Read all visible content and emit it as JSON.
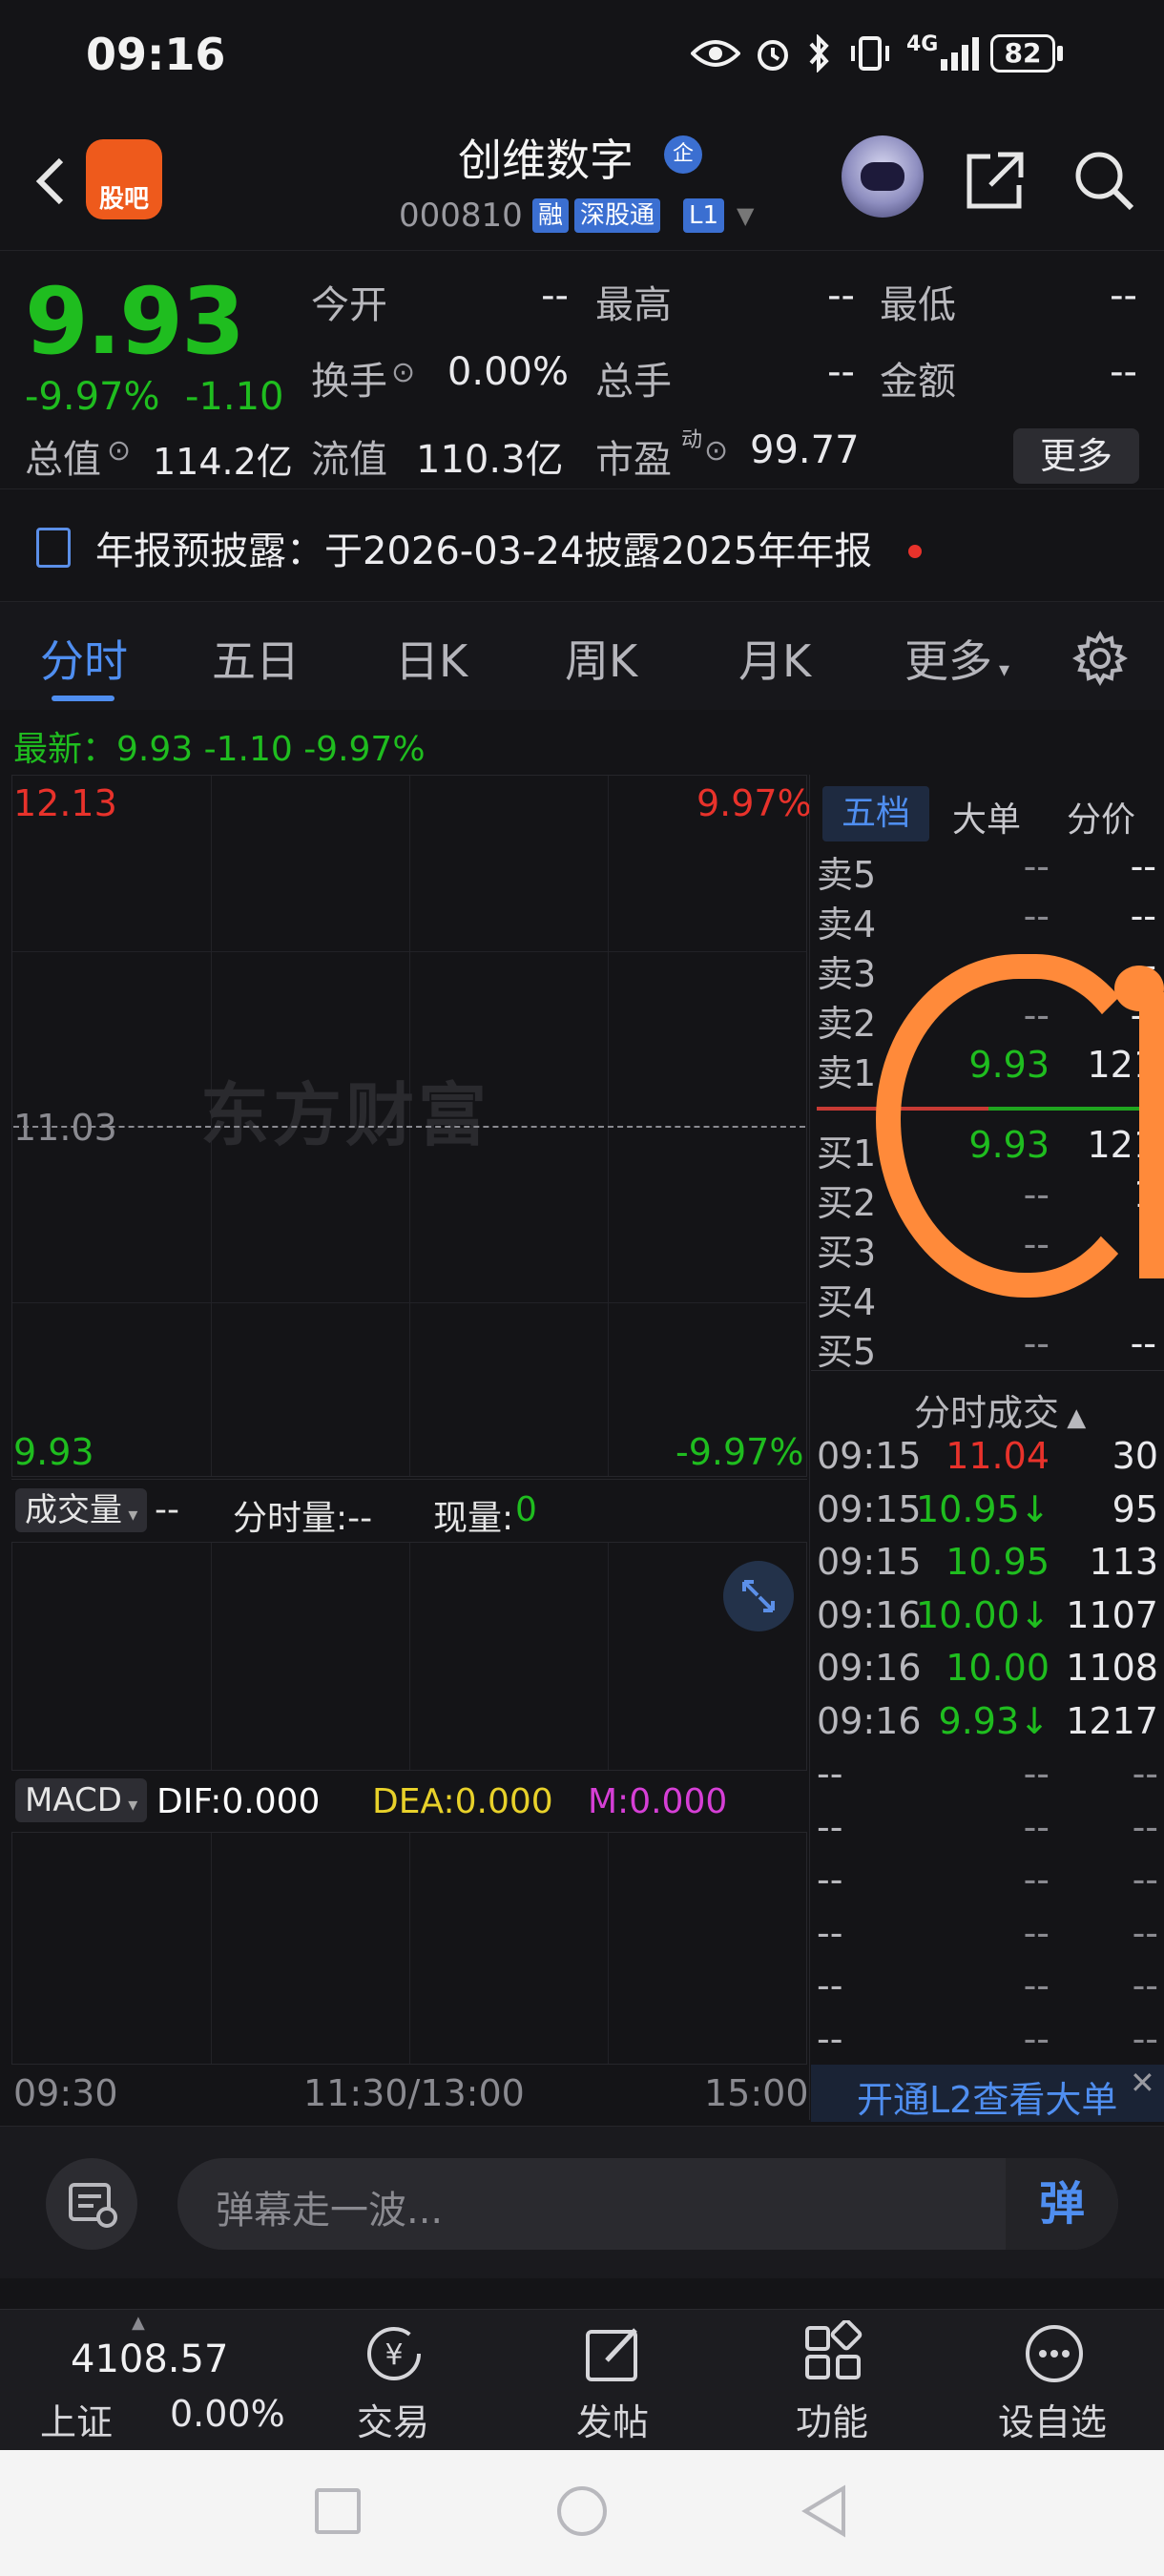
{
  "status_bar": {
    "time": "09:16",
    "network": "4G",
    "battery": "82"
  },
  "header": {
    "logo_text": "股吧",
    "stock_name": "创维数字",
    "badge": "企",
    "code": "000810",
    "tags": [
      "融",
      "深股通",
      "L1"
    ]
  },
  "quote": {
    "price": "9.93",
    "change_pct": "-9.97%",
    "change": "-1.10",
    "rows": [
      [
        {
          "label": "今开",
          "value": "--"
        },
        {
          "label": "最高",
          "value": "--"
        },
        {
          "label": "最低",
          "value": "--"
        }
      ],
      [
        {
          "label": "换手",
          "value": "0.00%"
        },
        {
          "label": "总手",
          "value": "--"
        },
        {
          "label": "金额",
          "value": "--"
        }
      ]
    ],
    "total_value_label": "总值",
    "total_value": "114.2亿",
    "float_value_label": "流值",
    "float_value": "110.3亿",
    "pe_label": "市盈",
    "pe_sup": "动",
    "pe_value": "99.77",
    "more_label": "更多"
  },
  "notice": {
    "text": "年报预披露：于2026-03-24披露2025年年报"
  },
  "chart_tabs": [
    "分时",
    "五日",
    "日K",
    "周K",
    "月K",
    "更多"
  ],
  "latest": "最新：9.93  -1.10  -9.97%",
  "chart": {
    "high_price": "12.13",
    "high_pct": "9.97%",
    "mid_price": "11.03",
    "low_price": "9.93",
    "low_pct": "-9.97%",
    "watermark": "东方财富",
    "volume_selector": "成交量",
    "volume_dash": "--",
    "minute_volume": "分时量:--",
    "current_volume_label": "现量:",
    "current_volume_value": "0",
    "macd_selector": "MACD",
    "dif": "DIF:0.000",
    "dea": "DEA:0.000",
    "m": "M:0.000",
    "time_start": "09:30",
    "time_mid": "11:30/13:00",
    "time_end": "15:00",
    "colors": {
      "up": "#e8322b",
      "down": "#1fbd1f",
      "dif": "#ffffff",
      "dea": "#e8d12a",
      "m": "#d63fd6"
    }
  },
  "order_book": {
    "tabs": [
      "五档",
      "大单",
      "分价"
    ],
    "asks": [
      {
        "label": "卖5",
        "price": "--",
        "volume": "--"
      },
      {
        "label": "卖4",
        "price": "--",
        "volume": "--"
      },
      {
        "label": "卖3",
        "price": "--",
        "volume": "--"
      },
      {
        "label": "卖2",
        "price": "--",
        "volume": "--"
      },
      {
        "label": "卖1",
        "price": "9.93",
        "volume": "121"
      }
    ],
    "bids": [
      {
        "label": "买1",
        "price": "9.93",
        "volume": "121"
      },
      {
        "label": "买2",
        "price": "--",
        "volume": "1"
      },
      {
        "label": "买3",
        "price": "--",
        "volume": "-"
      },
      {
        "label": "买4",
        "price": "",
        "volume": ""
      },
      {
        "label": "买5",
        "price": "--",
        "volume": "--"
      }
    ]
  },
  "trades": {
    "title": "分时成交",
    "rows": [
      {
        "time": "09:15",
        "price": "11.04",
        "volume": "30",
        "color": "#e8322b"
      },
      {
        "time": "09:15",
        "price": "10.95↓",
        "volume": "95",
        "color": "#1fbd1f"
      },
      {
        "time": "09:15",
        "price": "10.95",
        "volume": "113",
        "color": "#1fbd1f"
      },
      {
        "time": "09:16",
        "price": "10.00↓",
        "volume": "1107",
        "color": "#1fbd1f"
      },
      {
        "time": "09:16",
        "price": "10.00",
        "volume": "1108",
        "color": "#1fbd1f"
      },
      {
        "time": "09:16",
        "price": "9.93↓",
        "volume": "1217",
        "color": "#1fbd1f"
      },
      {
        "time": "--",
        "price": "--",
        "volume": "--",
        "color": "#8a8a90"
      },
      {
        "time": "--",
        "price": "--",
        "volume": "--",
        "color": "#8a8a90"
      },
      {
        "time": "--",
        "price": "--",
        "volume": "--",
        "color": "#8a8a90"
      },
      {
        "time": "--",
        "price": "--",
        "volume": "--",
        "color": "#8a8a90"
      },
      {
        "time": "--",
        "price": "--",
        "volume": "--",
        "color": "#8a8a90"
      },
      {
        "time": "--",
        "price": "--",
        "volume": "--",
        "color": "#8a8a90"
      }
    ],
    "l2_banner": "开通L2查看大单"
  },
  "danmu": {
    "placeholder": "弹幕走一波...",
    "toggle_label": "弹"
  },
  "bottom_nav": {
    "index_value": "4108.57",
    "index_name": "上证",
    "index_change": "0.00%",
    "items": [
      "交易",
      "发帖",
      "功能",
      "设自选"
    ]
  }
}
